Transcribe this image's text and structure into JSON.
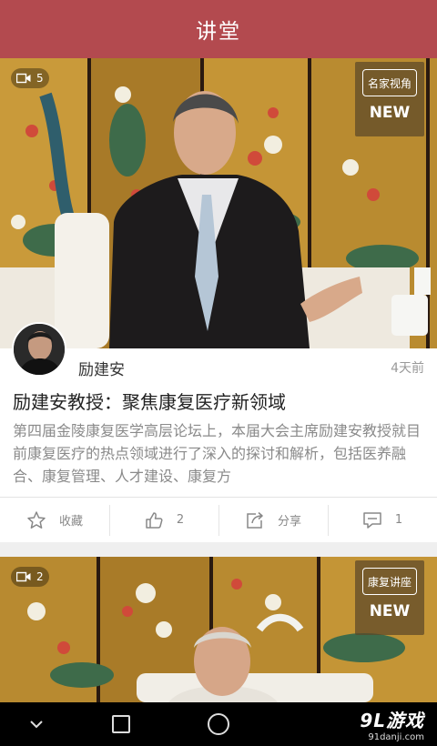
{
  "header": {
    "title": "讲堂"
  },
  "posts": [
    {
      "video_count": "5",
      "tag": "名家视角",
      "tag_new": "NEW",
      "author": "励建安",
      "time": "4天前",
      "title": "励建安教授：聚焦康复医疗新领域",
      "summary": "第四届金陵康复医学高层论坛上，本届大会主席励建安教授就目前康复医疗的热点领域进行了深入的探讨和解析，包括医养融合、康复管理、人才建设、康复方",
      "actions": {
        "favorite_label": "收藏",
        "like_count": "2",
        "share_label": "分享",
        "comment_count": "1"
      }
    },
    {
      "video_count": "2",
      "tag": "康复讲座",
      "tag_new": "NEW"
    }
  ],
  "watermark": {
    "main": "9L游戏",
    "sub": "91danji.com"
  },
  "colors": {
    "header": "#b34a4f",
    "text_primary": "#222222",
    "text_secondary": "#8a8a8a"
  }
}
